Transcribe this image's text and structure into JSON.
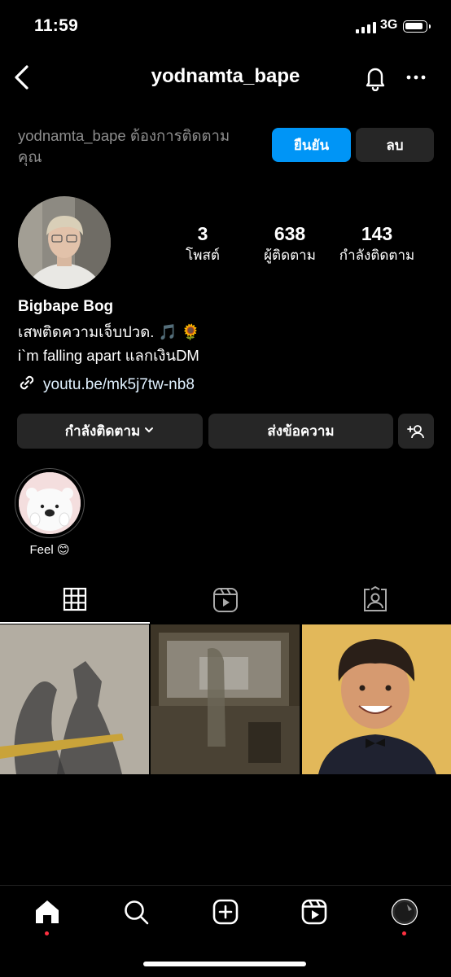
{
  "status": {
    "time": "11:59",
    "network": "3G"
  },
  "header": {
    "username": "yodnamta_bape"
  },
  "follow_request": {
    "text": "yodnamta_bape ต้องการติดตามคุณ",
    "confirm_label": "ยืนยัน",
    "delete_label": "ลบ"
  },
  "profile": {
    "stats": [
      {
        "value": "3",
        "label": "โพสต์"
      },
      {
        "value": "638",
        "label": "ผู้ติดตาม"
      },
      {
        "value": "143",
        "label": "กำลังติดตาม"
      }
    ],
    "display_name": "Bigbape Bog",
    "bio_line1": "เสพติดความเจ็บปวด. 🎵 🌻",
    "bio_line2": "i`m falling apart แลกเงินDM",
    "link": "youtu.be/mk5j7tw-nb8"
  },
  "actions": {
    "following_label": "กำลังติดตาม",
    "message_label": "ส่งข้อความ"
  },
  "highlights": [
    {
      "label": "Feel 😊"
    }
  ],
  "tabs": [
    "grid-icon",
    "reels-icon",
    "tagged-icon"
  ],
  "nav": [
    "home-icon",
    "search-icon",
    "create-icon",
    "reels-icon",
    "profile-avatar"
  ],
  "colors": {
    "accent": "#0095f6",
    "button_bg": "#262626",
    "muted_text": "#8e8e8e",
    "notification_dot": "#ff3040"
  }
}
